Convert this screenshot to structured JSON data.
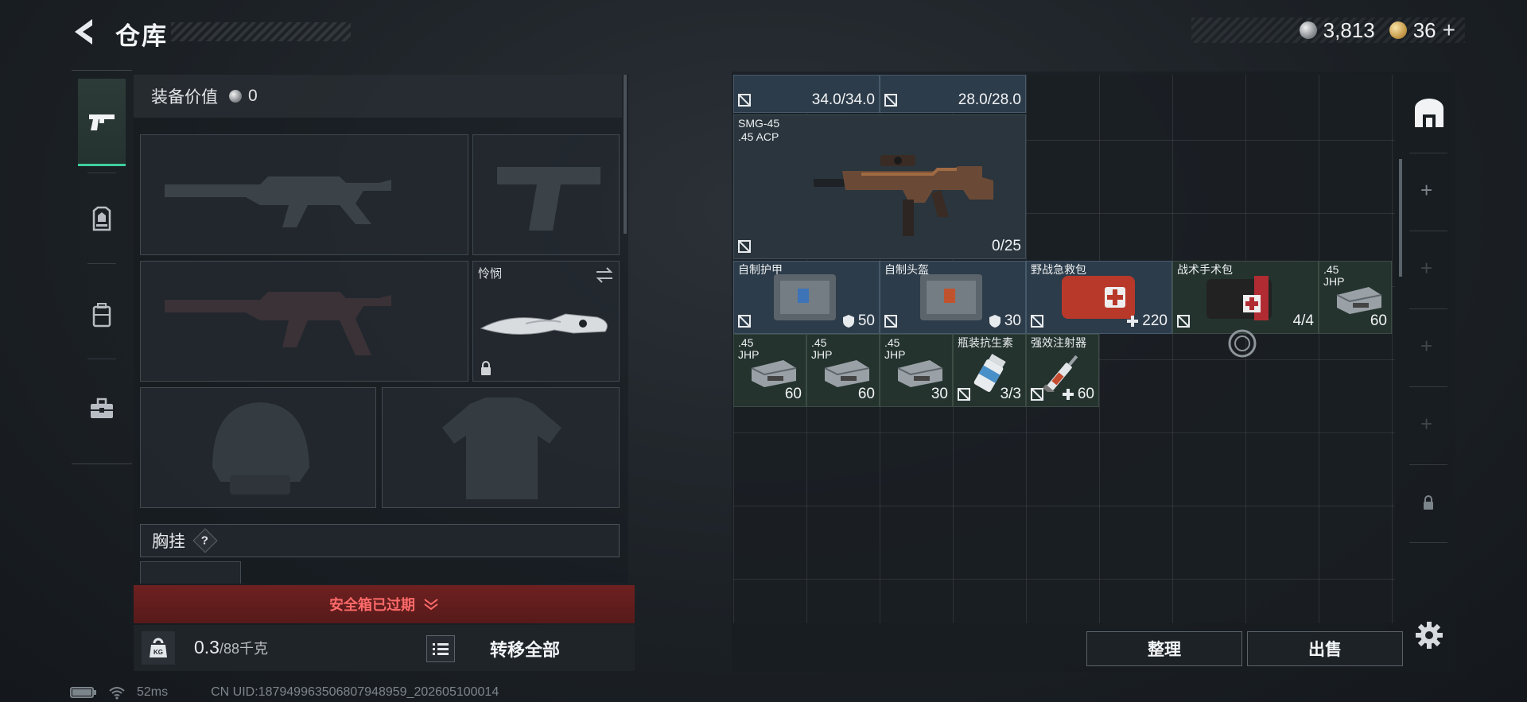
{
  "header": {
    "title": "仓库"
  },
  "currency": {
    "silver_value": "3,813",
    "gold_value": "36",
    "gold_plus": "+"
  },
  "equipment": {
    "value_label": "装备价值",
    "value_amount": "0",
    "melee_label": "怜悯",
    "chest_label": "胸挂",
    "help": "?"
  },
  "secure_box": {
    "text": "安全箱已过期"
  },
  "weight": {
    "current": "0.3",
    "max": "/88",
    "unit": "千克",
    "icon_text": "KG"
  },
  "actions": {
    "transfer_all": "转移全部",
    "organize": "整理",
    "sell": "出售"
  },
  "storage": {
    "top_row": {
      "armor_value": "34.0/34.0",
      "helmet_value": "28.0/28.0"
    },
    "gun": {
      "name": "SMG-45",
      "caliber": ".45 ACP",
      "ammo": "0/25"
    },
    "items": [
      {
        "name": "自制护甲",
        "qty": "50",
        "qty_icon": "shield"
      },
      {
        "name": "自制头盔",
        "qty": "30",
        "qty_icon": "shield"
      },
      {
        "name": "野战急救包",
        "qty": "220",
        "qty_icon": "plus"
      },
      {
        "name": "战术手术包",
        "qty": "4/4",
        "qty_icon": "none"
      },
      {
        "name": ".45\nJHP",
        "qty": "60",
        "qty_icon": "none"
      },
      {
        "name": ".45\nJHP",
        "qty": "60",
        "qty_icon": "none"
      },
      {
        "name": ".45\nJHP",
        "qty": "60",
        "qty_icon": "none"
      },
      {
        "name": ".45\nJHP",
        "qty": "30",
        "qty_icon": "none"
      },
      {
        "name": "瓶装抗生素",
        "qty": "3/3",
        "qty_icon": "none"
      },
      {
        "name": "强效注射器",
        "qty": "60",
        "qty_icon": "plus"
      }
    ]
  },
  "status_bar": {
    "ping": "52ms",
    "uid": "CN UID:187949963506807948959_202605100014"
  },
  "colors": {
    "accent_green": "#3ecf9e",
    "expired_red": "#ff6a6a"
  }
}
